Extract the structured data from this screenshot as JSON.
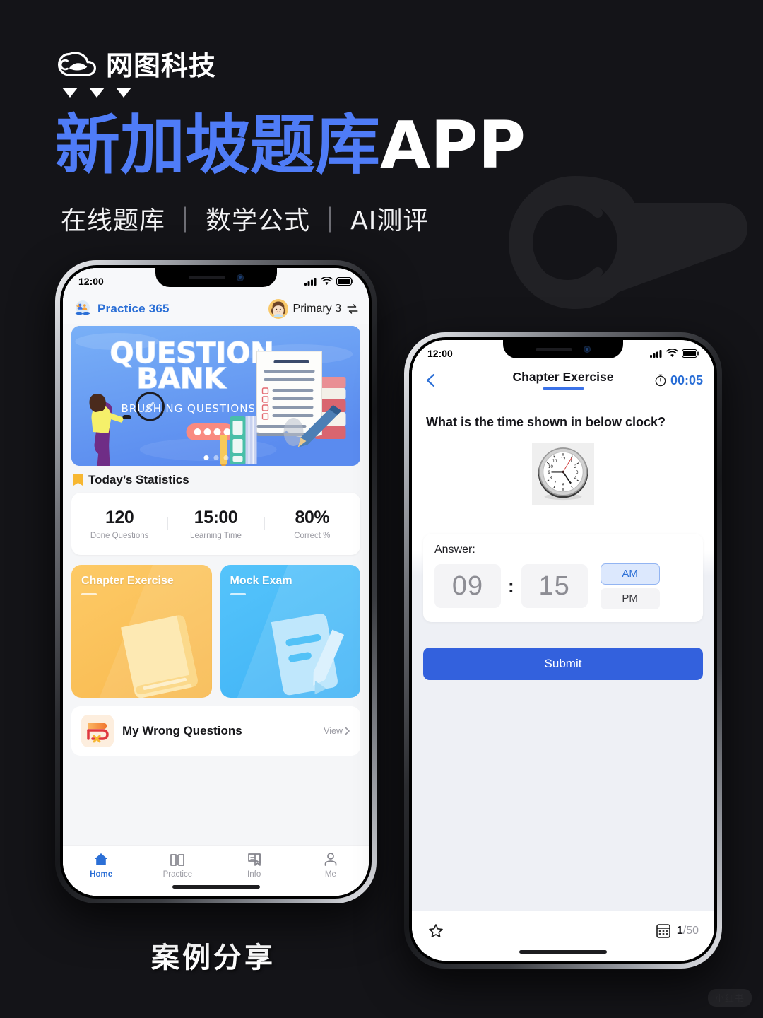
{
  "poster": {
    "brand_name": "网图科技",
    "brand_logo_icon": "cloud-logo-icon",
    "triangles_icon": "triangle-down-icon",
    "headline_blue": "新加坡题库",
    "headline_white": "APP",
    "subhead_items": [
      "在线题库",
      "数学公式",
      "AI测评"
    ],
    "subhead_separator": "｜",
    "caption": "案例分享",
    "corner_watermark": "小红书",
    "accent_blue": "#4f7cf7",
    "background": "#141418"
  },
  "phone1": {
    "status": {
      "time": "12:00",
      "signal_icon": "cellular-bars-icon",
      "wifi_icon": "wifi-icon",
      "battery_icon": "battery-icon"
    },
    "header": {
      "app_icon": "practice-365-logo-icon",
      "app_name": "Practice 365",
      "avatar_icon": "girl-avatar-icon",
      "grade": "Primary 3",
      "swap_icon": "swap-arrows-icon"
    },
    "banner": {
      "title_line1": "QUESTION",
      "title_line2": "BANK",
      "subtitle": "BRUSHING QUESTIONS",
      "dots": 3,
      "active_dot": 0
    },
    "section": {
      "icon": "book-icon",
      "title": "Today’s Statistics"
    },
    "stats": [
      {
        "value": "120",
        "label": "Done Questions"
      },
      {
        "value": "15:00",
        "label": "Learning Time"
      },
      {
        "value": "80%",
        "label": "Correct %"
      }
    ],
    "tiles": [
      {
        "title": "Chapter Exercise",
        "icon": "closed-book-icon",
        "color": "#f9b94f"
      },
      {
        "title": "Mock Exam",
        "icon": "exam-paper-pen-icon",
        "color": "#3fb2f5"
      }
    ],
    "wrong_questions": {
      "icon": "wrong-questions-icon",
      "title": "My Wrong Questions",
      "action": "View",
      "chevron_icon": "chevron-right-icon"
    },
    "tabs": [
      {
        "label": "Home",
        "icon": "home-icon",
        "active": true
      },
      {
        "label": "Practice",
        "icon": "open-book-icon",
        "active": false
      },
      {
        "label": "Info",
        "icon": "message-bookmark-icon",
        "active": false
      },
      {
        "label": "Me",
        "icon": "person-icon",
        "active": false
      }
    ]
  },
  "phone2": {
    "status": {
      "time": "12:00",
      "signal_icon": "cellular-bars-icon",
      "wifi_icon": "wifi-icon",
      "battery_icon": "battery-icon"
    },
    "nav": {
      "back_icon": "chevron-left-icon",
      "title": "Chapter Exercise",
      "timer_icon": "stopwatch-icon",
      "timer": "00:05"
    },
    "question": {
      "text": "What is the time shown in below clock?",
      "image_icon": "wall-clock-icon"
    },
    "answer": {
      "label": "Answer:",
      "hour": "09",
      "separator": ":",
      "minute": "15",
      "meridiem_options": [
        "AM",
        "PM"
      ],
      "meridiem_selected": "AM"
    },
    "submit_label": "Submit",
    "footer": {
      "star_icon": "star-outline-icon",
      "grid_icon": "question-grid-icon",
      "current_page": "1",
      "page_separator": "/",
      "total_pages": "50"
    }
  }
}
